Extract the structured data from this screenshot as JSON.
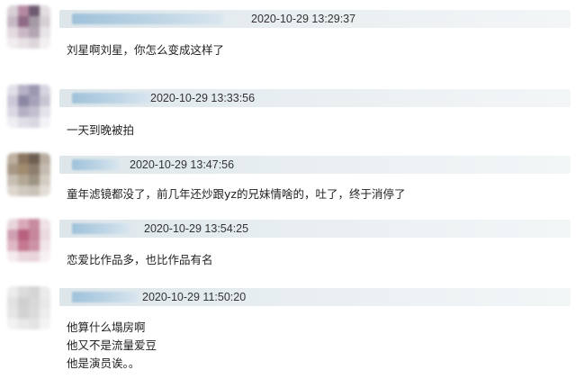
{
  "comments": [
    {
      "timestamp": "2020-10-29 13:29:37",
      "lines": [
        "刘星啊刘星，你怎么变成这样了"
      ],
      "avatar_colors": [
        "#d8d0d6",
        "#b58aa2",
        "#6e5a70",
        "#e3dde2",
        "#c7b9c4",
        "#8f6a86",
        "#a49aa5",
        "#d6d0d5",
        "#e2dadf",
        "#c9b7c5",
        "#b3a5b2",
        "#e8e4e7",
        "#f0ecef",
        "#e7e1e5",
        "#ddd7db",
        "#f3f0f2"
      ]
    },
    {
      "timestamp": "2020-10-29 13:33:56",
      "lines": [
        "一天到晚被拍"
      ],
      "avatar_colors": [
        "#e1dfe8",
        "#b8b2c7",
        "#9d98b2",
        "#d6d4df",
        "#cdc8d8",
        "#8c87a3",
        "#a7a2ba",
        "#c9c6d3",
        "#dad7e2",
        "#b5b0c4",
        "#c2bece",
        "#e3e1e9",
        "#efeef3",
        "#e0dee7",
        "#d9d7e1",
        "#f3f2f6"
      ]
    },
    {
      "timestamp": "2020-10-29 13:47:56",
      "lines": [
        "童年滤镜都没了，前几年还炒跟yz的兄妹情啥的，吐了，终于消停了"
      ],
      "avatar_colors": [
        "#bdb0a0",
        "#8a7560",
        "#6d5e52",
        "#b8ad9f",
        "#a89785",
        "#a08b6f",
        "#8d7d6d",
        "#c4bcb0",
        "#c8bfb3",
        "#b3a895",
        "#9e9485",
        "#d3ccc2",
        "#ddd7cf",
        "#cfc8be",
        "#c9c2b7",
        "#e2ddd6"
      ]
    },
    {
      "timestamp": "2020-10-29 13:54:25",
      "lines": [
        "恋爱比作品多，也比作品有名"
      ],
      "avatar_colors": [
        "#e9d6dc",
        "#d9a9b8",
        "#c78ca0",
        "#efe3e6",
        "#d0a0b2",
        "#b8607e",
        "#c6869c",
        "#ead9df",
        "#deb8c5",
        "#c47990",
        "#cc93a6",
        "#f1e6ea",
        "#f4ecef",
        "#ead8de",
        "#e9d6dd",
        "#f7f1f3"
      ]
    },
    {
      "timestamp": "2020-10-29 11:50:20",
      "lines": [
        "他算什么塌房啊",
        "他又不是流量爱豆",
        "他是演员诶。。"
      ],
      "avatar_colors": [
        "#ececec",
        "#dcdcdc",
        "#d4d4d4",
        "#ebebeb",
        "#e2e2e2",
        "#cfcfcf",
        "#d8d8d8",
        "#e8e8e8",
        "#e6e6e6",
        "#d3d3d3",
        "#dbdbdb",
        "#ededed",
        "#f2f2f2",
        "#e9e9e9",
        "#e4e4e4",
        "#f4f4f4"
      ]
    }
  ]
}
